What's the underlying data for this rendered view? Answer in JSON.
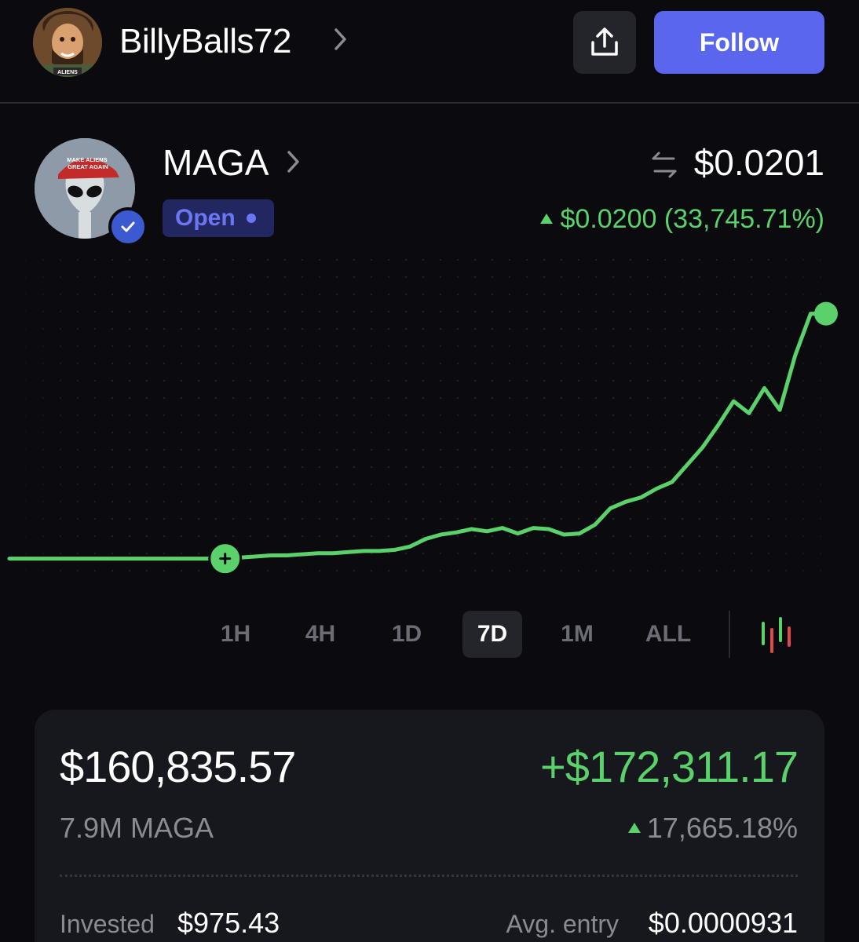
{
  "header": {
    "username": "BillyBalls72",
    "avatar_icon": "aliens-guy-avatar",
    "avatar_caption": "ALIENS",
    "share_icon": "share-upload-icon",
    "follow_label": "Follow",
    "follow_color": "#5b66ef"
  },
  "token": {
    "name": "MAGA",
    "avatar_icon": "alien-maga-hat-avatar",
    "hat_text": "MAKE ALIENS GREAT AGAIN",
    "verified_icon": "verified-badge-icon",
    "status": "Open",
    "swap_icon": "swap-arrows-icon",
    "price": "$0.0201",
    "change_amount": "$0.0200",
    "change_percent": "(33,745.71%)",
    "positive_color": "#5ad16a"
  },
  "chart_data": {
    "type": "line",
    "timeframe": "7D",
    "series": [
      {
        "values": [
          6,
          6,
          6,
          6,
          6,
          6,
          6,
          6,
          6,
          6,
          6,
          6,
          6,
          6,
          6,
          7,
          8,
          9,
          9,
          10,
          11,
          11,
          12,
          13,
          13,
          14,
          17,
          24,
          28,
          30,
          33,
          31,
          34,
          29,
          34,
          33,
          28,
          29,
          37,
          52,
          58,
          62,
          70,
          76,
          92,
          108,
          128,
          150,
          139,
          162,
          142,
          192,
          230,
          230
        ]
      }
    ],
    "entry_marker_index": 14,
    "ylim": [
      0,
      280
    ],
    "grid": "dotted"
  },
  "timeframes": [
    "1H",
    "4H",
    "1D",
    "7D",
    "1M",
    "ALL"
  ],
  "active_timeframe": "7D",
  "candle_icon": "candlestick-chart-icon",
  "position": {
    "value": "$160,835.57",
    "pnl": "+$172,311.17",
    "holdings": "7.9M MAGA",
    "pnl_percent": "17,665.18%",
    "invested_label": "Invested",
    "invested_value": "$975.43",
    "avg_entry_label": "Avg. entry",
    "avg_entry_value": "$0.0000931"
  }
}
